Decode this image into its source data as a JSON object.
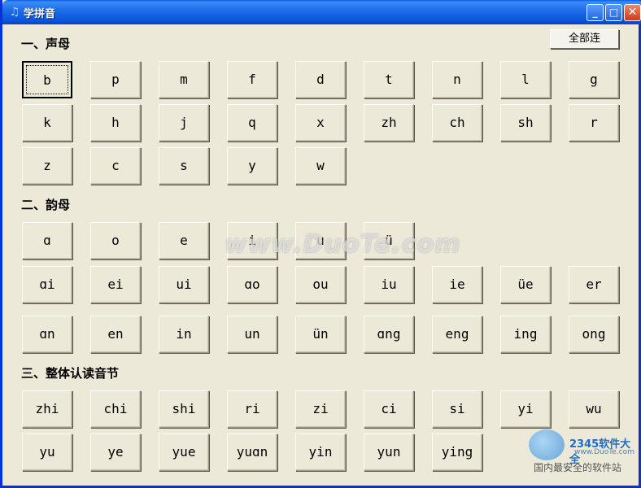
{
  "window": {
    "title": "学拼音",
    "min": "_",
    "max": "□",
    "close": "✕"
  },
  "toolbar": {
    "read_all": "全部连"
  },
  "sections": {
    "initials": "一、声母",
    "finals": "二、韵母",
    "whole": "三、整体认读音节"
  },
  "initials": [
    "b",
    "p",
    "m",
    "f",
    "d",
    "t",
    "n",
    "l",
    "g",
    "k",
    "h",
    "j",
    "q",
    "x",
    "zh",
    "ch",
    "sh",
    "r",
    "z",
    "c",
    "s",
    "y",
    "w"
  ],
  "finals_row1": [
    "ɑ",
    "o",
    "e",
    "i",
    "u",
    "ü"
  ],
  "finals_row2": [
    "ɑi",
    "ei",
    "ui",
    "ɑo",
    "ou",
    "iu",
    "ie",
    "üe",
    "er"
  ],
  "finals_row3": [
    "ɑn",
    "en",
    "in",
    "un",
    "ün",
    "ɑng",
    "eng",
    "ing",
    "ong"
  ],
  "whole_row1": [
    "zhi",
    "chi",
    "shi",
    "ri",
    "zi",
    "ci",
    "si",
    "yi",
    "wu"
  ],
  "whole_row2": [
    "yu",
    "ye",
    "yue",
    "yuɑn",
    "yin",
    "yun",
    "ying"
  ],
  "watermark": "www.DuoTe.com",
  "brand": {
    "name": "2345软件大全",
    "url": "www.DuoTe.com",
    "tagline": "国内最安全的软件站"
  },
  "colors": {
    "titlebar": "#0B55D8",
    "face": "#ECE9D8"
  },
  "icons": {
    "app": "music-note-icon"
  }
}
